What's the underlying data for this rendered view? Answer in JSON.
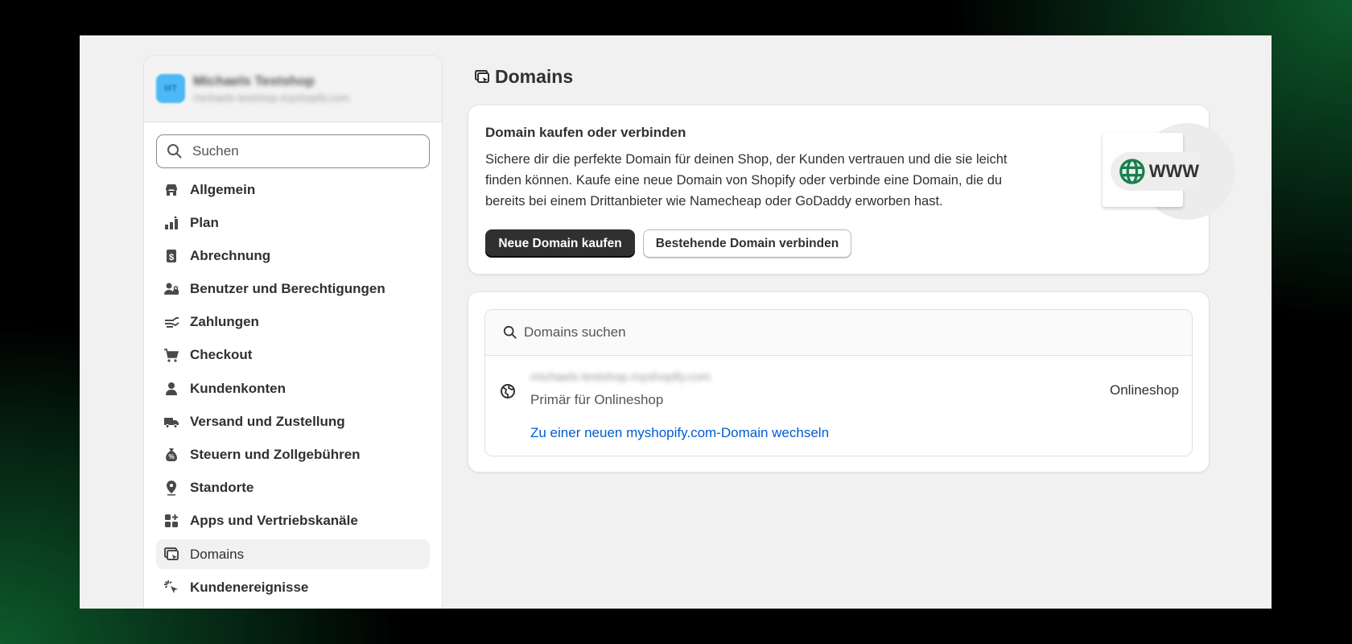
{
  "shop": {
    "initials": "MT",
    "name": "Michaels Testshop",
    "url": "michaels-testshop.myshopify.com"
  },
  "sidebar": {
    "search_placeholder": "Suchen",
    "items": [
      {
        "label": "Allgemein",
        "icon": "store-icon"
      },
      {
        "label": "Plan",
        "icon": "plan-icon"
      },
      {
        "label": "Abrechnung",
        "icon": "receipt-icon"
      },
      {
        "label": "Benutzer und Berechtigungen",
        "icon": "users-icon"
      },
      {
        "label": "Zahlungen",
        "icon": "payment-icon"
      },
      {
        "label": "Checkout",
        "icon": "cart-icon"
      },
      {
        "label": "Kundenkonten",
        "icon": "person-icon"
      },
      {
        "label": "Versand und Zustellung",
        "icon": "truck-icon"
      },
      {
        "label": "Steuern und Zollgebühren",
        "icon": "tax-icon"
      },
      {
        "label": "Standorte",
        "icon": "location-icon"
      },
      {
        "label": "Apps und Vertriebskanäle",
        "icon": "apps-icon"
      },
      {
        "label": "Domains",
        "icon": "domains-icon",
        "selected": true
      },
      {
        "label": "Kundenereignisse",
        "icon": "cursor-icon"
      }
    ]
  },
  "page": {
    "title": "Domains"
  },
  "promo": {
    "heading": "Domain kaufen oder verbinden",
    "body": "Sichere dir die perfekte Domain für deinen Shop, der Kunden vertrauen und die sie leicht finden können. Kaufe eine neue Domain von Shopify oder verbinde eine Domain, die du bereits bei einem Drittanbieter wie Namecheap oder GoDaddy erworben hast.",
    "buy_label": "Neue Domain kaufen",
    "connect_label": "Bestehende Domain verbinden",
    "illustration_text": "WWW"
  },
  "domains": {
    "search_placeholder": "Domains suchen",
    "rows": [
      {
        "name": "michaels-testshop.myshopify.com",
        "status": "Primär für Onlineshop",
        "channel": "Onlineshop",
        "link": "Zu einer neuen myshopify.com-Domain wechseln"
      }
    ]
  },
  "colors": {
    "accent": "#303030",
    "link": "#005bd3",
    "globe": "#1a7f4f",
    "avatar": "#4cb8f5"
  }
}
